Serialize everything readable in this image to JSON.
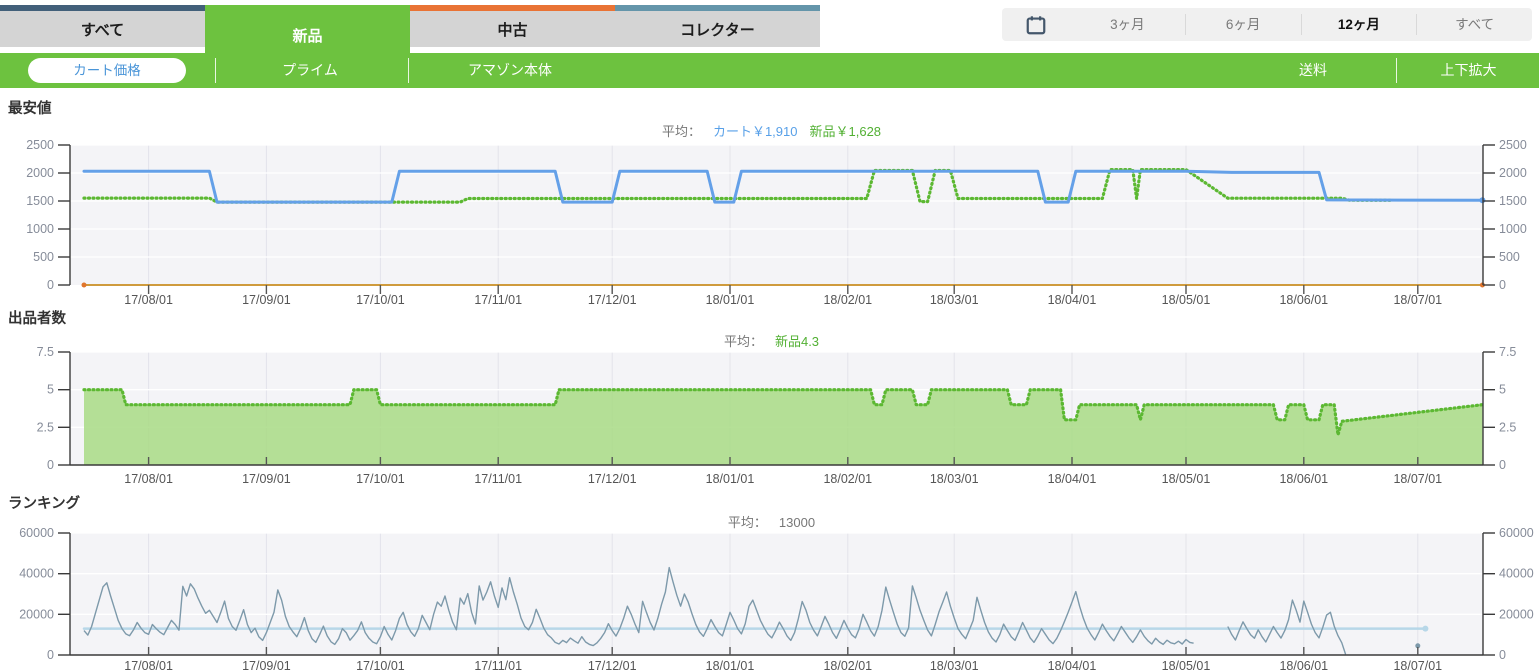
{
  "header": {
    "tabs": [
      {
        "label": "すべて",
        "accent": "#42607a",
        "active": false
      },
      {
        "label": "新品",
        "accent": "#6dc23f",
        "active": true
      },
      {
        "label": "中古",
        "accent": "#e97335",
        "active": false
      },
      {
        "label": "コレクター",
        "accent": "#6495aa",
        "active": false
      }
    ],
    "ranges": [
      {
        "label": "3ヶ月",
        "active": false
      },
      {
        "label": "6ヶ月",
        "active": false
      },
      {
        "label": "12ヶ月",
        "active": true
      },
      {
        "label": "すべて",
        "active": false
      }
    ],
    "calendar_icon": "calendar-icon",
    "calendar_icon_color": "#44576b"
  },
  "toolbar": {
    "active_item": "カート価格",
    "items": [
      {
        "label": "カート価格",
        "active": true
      },
      {
        "label": "プライム",
        "active": false
      },
      {
        "label": "アマゾン本体",
        "active": false
      }
    ],
    "right_items": [
      {
        "label": "送料"
      },
      {
        "label": "上下拡大"
      }
    ],
    "bar_color": "#6dc23f",
    "active_text_color": "#4a95d8"
  },
  "timeline": {
    "domain_days": 368,
    "months": [
      {
        "day": 17,
        "label": "17/08/01"
      },
      {
        "day": 48,
        "label": "17/09/01"
      },
      {
        "day": 78,
        "label": "17/10/01"
      },
      {
        "day": 109,
        "label": "17/11/01"
      },
      {
        "day": 139,
        "label": "17/12/01"
      },
      {
        "day": 170,
        "label": "18/01/01"
      },
      {
        "day": 201,
        "label": "18/02/01"
      },
      {
        "day": 229,
        "label": "18/03/01"
      },
      {
        "day": 260,
        "label": "18/04/01"
      },
      {
        "day": 290,
        "label": "18/05/01"
      },
      {
        "day": 321,
        "label": "18/06/01"
      },
      {
        "day": 351,
        "label": "18/07/01"
      }
    ]
  },
  "chart_data": [
    {
      "type": "line",
      "title": "最安値",
      "average": {
        "prefix": "平均：",
        "parts": [
          {
            "text": "カート￥1,910",
            "color": "#58a0e8"
          },
          {
            "text": "新品￥1,628",
            "color": "#52b033"
          }
        ]
      },
      "ylim": [
        0,
        2500
      ],
      "yticks": [
        0,
        500,
        1000,
        1500,
        2000,
        2500
      ],
      "grid": true,
      "series": [
        {
          "name": "amazon-baseline",
          "color": "#cf9b3d",
          "width": 2,
          "points": [
            [
              0,
              0
            ],
            [
              368,
              0
            ]
          ],
          "dots": [
            [
              0,
              0
            ],
            [
              368,
              0
            ]
          ],
          "dot_color": "#e0752c"
        },
        {
          "name": "new-price",
          "color": "#5cb832",
          "width": 3.2,
          "dash": "1 3.5",
          "points": [
            [
              0,
              1552
            ],
            [
              33,
              1552
            ],
            [
              35,
              1480
            ],
            [
              99,
              1480
            ],
            [
              101,
              1545
            ],
            [
              206,
              1545
            ],
            [
              208,
              2045
            ],
            [
              218,
              2045
            ],
            [
              220,
              1490
            ],
            [
              222,
              1490
            ],
            [
              224,
              2045
            ],
            [
              228,
              2045
            ],
            [
              230,
              1545
            ],
            [
              268,
              1545
            ],
            [
              270,
              2060
            ],
            [
              276,
              2060
            ],
            [
              277,
              1545
            ],
            [
              278,
              2060
            ],
            [
              290,
              2060
            ],
            [
              301,
              1550
            ],
            [
              331,
              1550
            ],
            [
              333,
              1515
            ],
            [
              344,
              1512
            ]
          ]
        },
        {
          "name": "cart-price",
          "color": "#64a0e8",
          "width": 3,
          "points": [
            [
              0,
              2030
            ],
            [
              33,
              2030
            ],
            [
              35,
              1480
            ],
            [
              81,
              1480
            ],
            [
              83,
              2030
            ],
            [
              124,
              2030
            ],
            [
              126,
              1480
            ],
            [
              139,
              1480
            ],
            [
              141,
              2030
            ],
            [
              164,
              2030
            ],
            [
              166,
              1480
            ],
            [
              171,
              1480
            ],
            [
              173,
              2030
            ],
            [
              251,
              2030
            ],
            [
              253,
              1480
            ],
            [
              259,
              1480
            ],
            [
              261,
              2030
            ],
            [
              290,
              2030
            ],
            [
              302,
              2010
            ],
            [
              325,
              2010
            ],
            [
              327,
              1520
            ],
            [
              368,
              1512
            ]
          ],
          "end_dot": true
        }
      ]
    },
    {
      "type": "area",
      "title": "出品者数",
      "average": {
        "prefix": "平均：",
        "parts": [
          {
            "text": "新品4.3",
            "color": "#52b033"
          }
        ]
      },
      "ylim": [
        0,
        7.5
      ],
      "yticks": [
        0,
        2.5,
        5,
        7.5
      ],
      "grid": true,
      "series": [
        {
          "name": "new-seller-count",
          "type": "area",
          "color": "#5cb832",
          "width": 3.2,
          "dash": "1 3.5",
          "fill": "#a8da85",
          "fill_opacity": 0.85,
          "points": [
            [
              0,
              5
            ],
            [
              10,
              5
            ],
            [
              11,
              4
            ],
            [
              70,
              4
            ],
            [
              71,
              5
            ],
            [
              77,
              5
            ],
            [
              78,
              4
            ],
            [
              124,
              4
            ],
            [
              125,
              5
            ],
            [
              207,
              5
            ],
            [
              208,
              4
            ],
            [
              210,
              4
            ],
            [
              211,
              5
            ],
            [
              218,
              5
            ],
            [
              219,
              4
            ],
            [
              222,
              4
            ],
            [
              223,
              5
            ],
            [
              243,
              5
            ],
            [
              244,
              4
            ],
            [
              248,
              4
            ],
            [
              249,
              5
            ],
            [
              257,
              5
            ],
            [
              258,
              3
            ],
            [
              261,
              3
            ],
            [
              262,
              4
            ],
            [
              277,
              4
            ],
            [
              278,
              3
            ],
            [
              279,
              4
            ],
            [
              313,
              4
            ],
            [
              314,
              3
            ],
            [
              316,
              3
            ],
            [
              317,
              4
            ],
            [
              321,
              4
            ],
            [
              322,
              3
            ],
            [
              325,
              3
            ],
            [
              326,
              4
            ],
            [
              329,
              4
            ],
            [
              330,
              2
            ],
            [
              331,
              2.9
            ],
            [
              368,
              4
            ]
          ]
        }
      ]
    },
    {
      "type": "line",
      "title": "ランキング",
      "average": {
        "prefix": "平均：",
        "parts": [
          {
            "text": "13000",
            "color": "#777777"
          }
        ]
      },
      "ylim": [
        0,
        60000
      ],
      "yticks": [
        0,
        20000,
        40000,
        60000
      ],
      "grid": true,
      "series": [
        {
          "name": "rank-average-line",
          "color": "#b7d7e8",
          "width": 2.5,
          "points": [
            [
              0,
              13000
            ],
            [
              353,
              13000
            ]
          ],
          "end_dot": true
        },
        {
          "name": "sales-rank",
          "type": "noise",
          "color": "#7d99aa",
          "width": 1.4,
          "value_scale": 1000,
          "segments": [
            {
              "start_day": 0,
              "values": [
                12,
                9.8,
                14,
                20.5,
                27,
                33.5,
                35.5,
                29,
                23,
                17,
                13,
                10.4,
                9.5,
                12.3,
                16,
                13.2,
                11,
                10.2,
                15,
                13,
                11.2,
                10,
                13.5,
                17,
                15,
                12.2,
                33.8,
                29,
                35,
                32.5,
                28,
                24,
                20.5,
                22,
                19,
                16,
                21,
                26.5,
                18,
                14,
                12.2,
                17,
                22.3,
                15,
                11,
                13.2,
                9,
                7.2,
                11,
                16,
                21,
                32,
                27,
                19,
                14,
                11.3,
                9,
                13,
                18.4,
                12,
                8,
                6.2,
                10,
                14.2,
                9.4,
                6.5,
                5.2,
                8,
                13,
                11,
                7.3,
                9.5,
                12,
                16.3,
                11,
                8.2,
                6.4,
                5.5,
                9,
                14,
                10.2,
                7.4,
                12,
                18,
                21,
                15,
                11.4,
                9.2,
                13,
                19.5,
                16,
                12.4,
                20,
                26,
                24,
                29,
                22,
                16.2,
                12.4,
                28,
                25,
                30.2,
                21,
                15.3,
                34,
                27,
                31,
                36,
                29,
                23.4,
                33,
                27.2,
                38,
                31,
                25,
                18.2,
                14,
                12.4,
                16,
                22.5,
                18,
                13.2,
                10,
                8.4,
                6.2,
                5.4,
                7.2,
                6.1,
                8.3,
                7,
                5.8,
                9,
                6.4,
                5.2,
                4.6,
                6,
                8.2,
                11,
                15.4,
                12,
                9.3,
                13,
                18,
                24,
                20,
                15.2,
                11,
                26.4,
                21,
                16,
                12.3,
                18,
                25,
                31,
                43,
                36,
                29.4,
                24,
                30,
                26,
                20.2,
                15,
                11.3,
                9.2,
                13,
                17.4,
                14,
                11,
                9.4,
                15,
                21,
                17.2,
                13,
                10.4,
                15.3,
                24,
                27,
                22,
                17,
                13.4,
                10.2,
                8.4,
                12,
                16.2,
                13,
                9.4,
                7.2,
                11,
                18,
                26.3,
                22,
                16,
                12.2,
                9.4,
                14,
                19,
                15.2,
                11,
                8.2,
                12.4,
                17,
                13.2,
                10,
                8.4,
                13,
                20,
                16.2,
                12,
                9.3,
                14,
                22,
                33.4,
                27,
                21,
                15.2,
                11,
                9.2,
                13.4,
                34,
                28.2,
                22,
                17,
                12.3,
                9.4,
                15,
                21.2,
                26,
                31,
                24,
                18.2,
                13,
                10.2,
                8,
                12.4,
                17,
                28.4,
                22,
                16,
                11.3,
                8.2,
                6.4,
                10,
                15.2,
                12,
                9,
                7.2,
                11.4,
                16,
                12.2,
                8.4,
                6.2,
                9.3,
                13,
                10.2,
                7.4,
                5.6,
                8.2,
                12,
                16.4,
                21,
                26,
                31.2,
                24,
                18,
                13.2,
                10,
                7.4,
                11,
                15.2,
                12,
                9.2,
                7,
                10.4,
                14,
                11.2,
                8.4,
                6.2,
                9,
                12.4,
                9.2,
                7,
                5.4,
                8.2,
                6.4,
                5.2,
                7.3,
                6,
                5.5,
                6.8,
                5.4,
                7.6,
                6.2,
                5.8
              ]
            },
            {
              "start_day": 301,
              "values": [
                14,
                10.2,
                7.4,
                12,
                16.3,
                13,
                10,
                8.2,
                12.4,
                9,
                6.4,
                10.2,
                14,
                11,
                8.3,
                12,
                17.4,
                27,
                22,
                16.2,
                26.5,
                21,
                15.2,
                11,
                8.4,
                13.6,
                19.6,
                21,
                14.2,
                9.5,
                6,
                0.3
              ]
            }
          ],
          "dots": [
            [
              351,
              4500
            ]
          ]
        }
      ]
    }
  ],
  "colors": {
    "brand_green": "#6dc23f",
    "cart_blue": "#64a0e8",
    "new_green": "#5cb832",
    "rank_slate": "#7d99aa",
    "rank_avg_blue": "#b7d7e8",
    "amazon_orange": "#cf9b3d",
    "plot_bg": "#f4f4f7",
    "tab_gray": "#d4d4d4"
  }
}
